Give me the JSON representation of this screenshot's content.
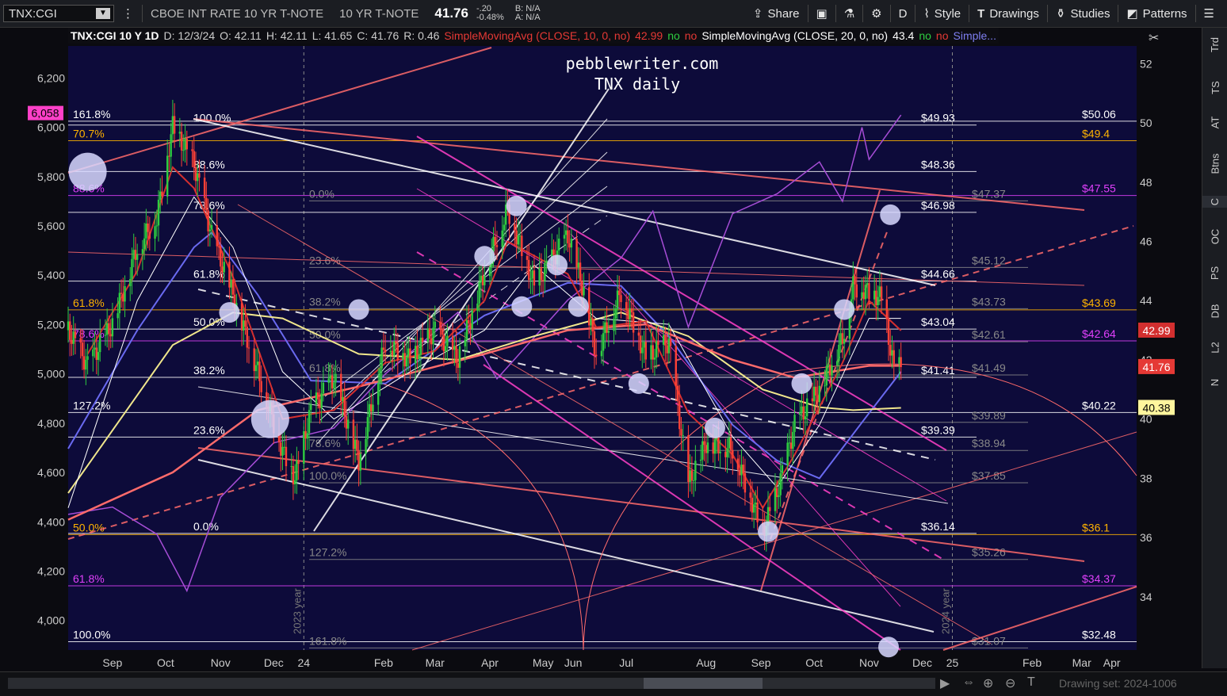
{
  "toolbar": {
    "symbol": "TNX:CGI",
    "description": "CBOE INT RATE 10 YR T-NOTE",
    "short_description": "10 YR T-NOTE",
    "last": "41.76",
    "change": "-.20",
    "change_pct": "-0.48%",
    "bid": "B: N/A",
    "ask": "A: N/A",
    "share_label": "Share",
    "period_label": "D",
    "style_label": "Style",
    "drawings_label": "Drawings",
    "studies_label": "Studies",
    "patterns_label": "Patterns",
    "icons": [
      "ellipsis-icon",
      "share-icon",
      "snapshot-icon",
      "flask-icon",
      "gear-icon",
      "style-icon",
      "drawings-icon",
      "studies-icon",
      "patterns-icon",
      "menu-icon"
    ]
  },
  "status": {
    "title": "TNX:CGI 10 Y 1D",
    "date": "D: 12/3/24",
    "open": "O: 42.11",
    "high": "H: 42.11",
    "low": "L: 41.65",
    "close": "C: 41.76",
    "range": "R: 0.46",
    "sma10_label": "SimpleMovingAvg (CLOSE, 10, 0, no)",
    "sma10_value": "42.99",
    "sma10_no1": "no",
    "sma10_no2": "no",
    "sma20_label": "SimpleMovingAvg (CLOSE, 20, 0, no)",
    "sma20_value": "43.4",
    "sma20_no1": "no",
    "sma20_no2": "no",
    "more_label": "Simple..."
  },
  "chart_data": {
    "type": "candlestick",
    "watermark": [
      "pebblewriter.com",
      "TNX daily"
    ],
    "y_left": {
      "ticks": [
        "6,200",
        "6,000",
        "5,800",
        "5,600",
        "5,400",
        "5,200",
        "5,000",
        "4,800",
        "4,600",
        "4,400",
        "4,200",
        "4,000"
      ],
      "range": [
        3880,
        6330
      ],
      "highlight": "6,058"
    },
    "y_right": {
      "ticks": [
        "52",
        "50",
        "48",
        "46",
        "44",
        "42",
        "40",
        "38",
        "36",
        "34"
      ],
      "range": [
        32.2,
        52.6
      ]
    },
    "x_ticks": [
      "Sep",
      "Oct",
      "Nov",
      "Dec",
      "24",
      "Feb",
      "Mar",
      "Apr",
      "May",
      "Jun",
      "Jul",
      "Aug",
      "Sep",
      "Oct",
      "Nov",
      "Dec",
      "25",
      "Feb",
      "Mar",
      "Apr"
    ],
    "year_markers": [
      "2023 year",
      "2024 year"
    ],
    "price_badges": [
      {
        "value": "42.99",
        "y": 42.99,
        "bg": "#d32f2f",
        "fg": "#ffffff"
      },
      {
        "value": "41.76",
        "y": 41.76,
        "bg": "#e53935",
        "fg": "#ffffff"
      },
      {
        "value": "40.38",
        "y": 40.38,
        "bg": "#fff59d",
        "fg": "#000000"
      }
    ],
    "fib_levels": [
      {
        "y": 50.06,
        "color": "#ffffff",
        "left_label": "161.8%",
        "right_label": "$50.06",
        "right_color": "#ffffff"
      },
      {
        "y": 49.93,
        "color": "#ffffff",
        "left_label": "100.0%",
        "right_label": "$49.93",
        "right_color": "#ffffff"
      },
      {
        "y": 49.4,
        "color": "#ffb300",
        "left_label": "70.7%",
        "right_label": "$49.4",
        "right_color": "#ffb300"
      },
      {
        "y": 48.36,
        "color": "#ffffff",
        "left_label": "88.6%",
        "right_label": "$48.36",
        "right_color": "#ffffff"
      },
      {
        "y": 47.55,
        "color": "#e040fb",
        "left_label": "88.6%",
        "right_label": "$47.55",
        "right_color": "#e040fb"
      },
      {
        "y": 47.37,
        "color": "#888888",
        "left_label": "0.0%",
        "right_label": "$47.37",
        "right_color": "#888888"
      },
      {
        "y": 46.98,
        "color": "#ffffff",
        "left_label": "78.6%",
        "right_label": "$46.98",
        "right_color": "#ffffff"
      },
      {
        "y": 45.12,
        "color": "#888888",
        "left_label": "23.6%",
        "right_label": "$45.12",
        "right_color": "#888888"
      },
      {
        "y": 44.66,
        "color": "#ffffff",
        "left_label": "61.8%",
        "right_label": "$44.66",
        "right_color": "#ffffff"
      },
      {
        "y": 43.73,
        "color": "#888888",
        "left_label": "38.2%",
        "right_label": "$43.73",
        "right_color": "#888888"
      },
      {
        "y": 43.69,
        "color": "#ffb300",
        "left_label": "61.8%",
        "right_label": "$43.69",
        "right_color": "#ffb300"
      },
      {
        "y": 43.04,
        "color": "#ffffff",
        "left_label": "50.0%",
        "right_label": "$43.04",
        "right_color": "#ffffff"
      },
      {
        "y": 42.64,
        "color": "#e040fb",
        "left_label": "78.6%",
        "right_label": "$42.64",
        "right_color": "#e040fb"
      },
      {
        "y": 42.61,
        "color": "#888888",
        "left_label": "50.0%",
        "right_label": "$42.61",
        "right_color": "#888888"
      },
      {
        "y": 41.49,
        "color": "#888888",
        "left_label": "61.8%",
        "right_label": "$41.49",
        "right_color": "#888888"
      },
      {
        "y": 41.41,
        "color": "#ffffff",
        "left_label": "38.2%",
        "right_label": "$41.41",
        "right_color": "#ffffff"
      },
      {
        "y": 40.22,
        "color": "#ffffff",
        "left_label": "127.2%",
        "right_label": "$40.22",
        "right_color": "#ffffff"
      },
      {
        "y": 39.89,
        "color": "#888888",
        "left_label": "",
        "right_label": "$39.89",
        "right_color": "#888888"
      },
      {
        "y": 39.39,
        "color": "#ffffff",
        "left_label": "23.6%",
        "right_label": "$39.39",
        "right_color": "#ffffff"
      },
      {
        "y": 38.94,
        "color": "#888888",
        "left_label": "78.6%",
        "right_label": "$38.94",
        "right_color": "#888888"
      },
      {
        "y": 37.85,
        "color": "#888888",
        "left_label": "100.0%",
        "right_label": "$37.85",
        "right_color": "#888888"
      },
      {
        "y": 36.14,
        "color": "#ffffff",
        "left_label": "0.0%",
        "right_label": "$36.14",
        "right_color": "#ffffff"
      },
      {
        "y": 36.1,
        "color": "#ffb300",
        "left_label": "50.0%",
        "right_label": "$36.1",
        "right_color": "#ffb300"
      },
      {
        "y": 35.26,
        "color": "#888888",
        "left_label": "127.2%",
        "right_label": "$35.26",
        "right_color": "#888888"
      },
      {
        "y": 34.37,
        "color": "#e040fb",
        "left_label": "61.8%",
        "right_label": "$34.37",
        "right_color": "#e040fb"
      },
      {
        "y": 32.48,
        "color": "#ffffff",
        "left_label": "100.0%",
        "right_label": "$32.48",
        "right_color": "#ffffff"
      },
      {
        "y": 32.27,
        "color": "#888888",
        "left_label": "161.8%",
        "right_label": "$31.07",
        "right_color": "#888888"
      }
    ],
    "price_path": [
      [
        "2023-08-21",
        43.0
      ],
      [
        "2023-09-01",
        41.8
      ],
      [
        "2023-09-15",
        43.2
      ],
      [
        "2023-09-29",
        45.8
      ],
      [
        "2023-10-10",
        46.8
      ],
      [
        "2023-10-19",
        49.9
      ],
      [
        "2023-10-31",
        48.6
      ],
      [
        "2023-11-10",
        46.2
      ],
      [
        "2023-11-22",
        44.2
      ],
      [
        "2023-12-06",
        41.6
      ],
      [
        "2023-12-20",
        38.9
      ],
      [
        "2023-12-27",
        38.0
      ],
      [
        "2024-01-05",
        40.3
      ],
      [
        "2024-01-18",
        41.4
      ],
      [
        "2024-02-01",
        38.6
      ],
      [
        "2024-02-16",
        42.6
      ],
      [
        "2024-03-01",
        42.0
      ],
      [
        "2024-03-15",
        43.0
      ],
      [
        "2024-03-28",
        42.0
      ],
      [
        "2024-04-12",
        45.0
      ],
      [
        "2024-04-25",
        47.1
      ],
      [
        "2024-05-10",
        44.5
      ],
      [
        "2024-05-29",
        46.2
      ],
      [
        "2024-06-07",
        44.3
      ],
      [
        "2024-06-14",
        42.2
      ],
      [
        "2024-06-28",
        44.3
      ],
      [
        "2024-07-12",
        42.1
      ],
      [
        "2024-07-25",
        42.6
      ],
      [
        "2024-08-05",
        37.8
      ],
      [
        "2024-08-15",
        39.2
      ],
      [
        "2024-08-30",
        39.0
      ],
      [
        "2024-09-16",
        36.2
      ],
      [
        "2024-09-24",
        37.5
      ],
      [
        "2024-10-04",
        39.8
      ],
      [
        "2024-10-18",
        41.0
      ],
      [
        "2024-10-31",
        42.7
      ],
      [
        "2024-11-06",
        44.5
      ],
      [
        "2024-11-15",
        44.3
      ],
      [
        "2024-11-22",
        44.1
      ],
      [
        "2024-11-29",
        41.7
      ],
      [
        "2024-12-03",
        41.76
      ]
    ],
    "sma_fast_path": [
      [
        "2023-09-01",
        42.2
      ],
      [
        "2023-09-29",
        45.0
      ],
      [
        "2023-10-19",
        48.5
      ],
      [
        "2023-10-31",
        47.8
      ],
      [
        "2023-11-22",
        44.8
      ],
      [
        "2023-12-20",
        40.0
      ],
      [
        "2024-01-18",
        40.3
      ],
      [
        "2024-02-16",
        41.9
      ],
      [
        "2024-03-15",
        42.3
      ],
      [
        "2024-04-12",
        44.0
      ],
      [
        "2024-04-25",
        46.0
      ],
      [
        "2024-05-29",
        44.9
      ],
      [
        "2024-06-14",
        43.1
      ],
      [
        "2024-07-12",
        43.3
      ],
      [
        "2024-08-05",
        40.2
      ],
      [
        "2024-08-30",
        38.8
      ],
      [
        "2024-09-16",
        37.0
      ],
      [
        "2024-10-04",
        38.8
      ],
      [
        "2024-10-31",
        41.9
      ],
      [
        "2024-11-15",
        44.0
      ],
      [
        "2024-12-03",
        42.99
      ]
    ],
    "sma_mid_path": [
      [
        "2023-08-21",
        37.0
      ],
      [
        "2023-09-29",
        44.0
      ],
      [
        "2023-10-31",
        47.5
      ],
      [
        "2023-11-22",
        45.8
      ],
      [
        "2023-12-20",
        41.6
      ],
      [
        "2024-01-18",
        40.0
      ],
      [
        "2024-03-01",
        41.6
      ],
      [
        "2024-04-12",
        43.0
      ],
      [
        "2024-05-10",
        45.2
      ],
      [
        "2024-06-14",
        43.4
      ],
      [
        "2024-07-25",
        43.2
      ],
      [
        "2024-08-30",
        39.4
      ],
      [
        "2024-09-24",
        37.7
      ],
      [
        "2024-10-18",
        39.8
      ],
      [
        "2024-11-15",
        43.4
      ],
      [
        "2024-12-03",
        43.4
      ]
    ],
    "sma_blue_path": [
      [
        "2023-08-21",
        39.0
      ],
      [
        "2023-09-29",
        43.0
      ],
      [
        "2023-10-31",
        45.8
      ],
      [
        "2023-11-10",
        46.3
      ],
      [
        "2023-12-06",
        44.2
      ],
      [
        "2024-01-05",
        41.3
      ],
      [
        "2024-02-16",
        41.2
      ],
      [
        "2024-04-12",
        43.5
      ],
      [
        "2024-05-29",
        44.6
      ],
      [
        "2024-06-28",
        44.5
      ],
      [
        "2024-07-25",
        42.8
      ],
      [
        "2024-08-30",
        39.8
      ],
      [
        "2024-09-24",
        38.6
      ],
      [
        "2024-10-18",
        38.0
      ],
      [
        "2024-11-15",
        40.2
      ],
      [
        "2024-12-03",
        41.6
      ]
    ],
    "sma_yellow_path": [
      [
        "2023-08-21",
        37.5
      ],
      [
        "2023-10-19",
        42.5
      ],
      [
        "2023-11-22",
        43.6
      ],
      [
        "2023-12-20",
        43.4
      ],
      [
        "2024-02-01",
        42.2
      ],
      [
        "2024-03-28",
        42.0
      ],
      [
        "2024-05-10",
        42.8
      ],
      [
        "2024-06-28",
        43.6
      ],
      [
        "2024-08-05",
        42.8
      ],
      [
        "2024-09-16",
        41.0
      ],
      [
        "2024-10-18",
        40.4
      ],
      [
        "2024-11-06",
        40.3
      ],
      [
        "2024-12-03",
        40.38
      ]
    ],
    "sma_red_path": [
      [
        "2023-08-21",
        36.6
      ],
      [
        "2023-10-19",
        38.2
      ],
      [
        "2023-12-06",
        40.3
      ],
      [
        "2024-02-01",
        41.1
      ],
      [
        "2024-04-12",
        42.2
      ],
      [
        "2024-05-29",
        43.0
      ],
      [
        "2024-07-12",
        43.2
      ],
      [
        "2024-08-30",
        42.0
      ],
      [
        "2024-10-04",
        41.4
      ],
      [
        "2024-11-15",
        41.8
      ],
      [
        "2024-12-03",
        41.8
      ]
    ],
    "spx_path": [
      [
        "2023-08-21",
        4430
      ],
      [
        "2023-09-15",
        4460
      ],
      [
        "2023-10-10",
        4350
      ],
      [
        "2023-10-27",
        4120
      ],
      [
        "2023-11-15",
        4500
      ],
      [
        "2023-12-15",
        4720
      ],
      [
        "2024-01-18",
        4780
      ],
      [
        "2024-02-16",
        5000
      ],
      [
        "2024-03-28",
        5250
      ],
      [
        "2024-04-19",
        4980
      ],
      [
        "2024-05-29",
        5300
      ],
      [
        "2024-06-28",
        5470
      ],
      [
        "2024-07-16",
        5660
      ],
      [
        "2024-08-05",
        5190
      ],
      [
        "2024-08-30",
        5650
      ],
      [
        "2024-09-24",
        5730
      ],
      [
        "2024-10-18",
        5860
      ],
      [
        "2024-10-31",
        5700
      ],
      [
        "2024-11-11",
        6000
      ],
      [
        "2024-11-15",
        5870
      ],
      [
        "2024-12-03",
        6050
      ]
    ],
    "circles": [
      [
        "2023-09-01",
        5820
      ],
      [
        "2023-11-20",
        43.6
      ],
      [
        "2023-12-13",
        40.0
      ],
      [
        "2024-02-01",
        43.7
      ],
      [
        "2024-04-12",
        45.5
      ],
      [
        "2024-04-30",
        47.2
      ],
      [
        "2024-05-03",
        43.8
      ],
      [
        "2024-05-23",
        45.2
      ],
      [
        "2024-06-04",
        43.8
      ],
      [
        "2024-07-08",
        41.2
      ],
      [
        "2024-08-20",
        39.7
      ],
      [
        "2024-09-19",
        36.2
      ],
      [
        "2024-10-08",
        41.2
      ],
      [
        "2024-11-01",
        43.7
      ],
      [
        "2024-11-27",
        46.9
      ],
      [
        "2024-11-26",
        32.3
      ]
    ],
    "legend": [
      "TNX:CGI",
      "SimpleMovingAvg (CLOSE, 10, 0, no)",
      "SimpleMovingAvg (CLOSE, 20, 0, no)"
    ]
  },
  "rightbar": {
    "tabs": [
      "Trd",
      "TS",
      "AT",
      "Btns",
      "C",
      "OC",
      "PS",
      "DB",
      "L2",
      "N"
    ]
  },
  "bottombar": {
    "drawing_set": "Drawing set: 2024-1006",
    "icons": [
      "scroll-left-icon",
      "scroll-right-icon",
      "zoom-in-icon",
      "zoom-out-icon",
      "zoom-reset-icon",
      "text-tool-icon"
    ]
  }
}
